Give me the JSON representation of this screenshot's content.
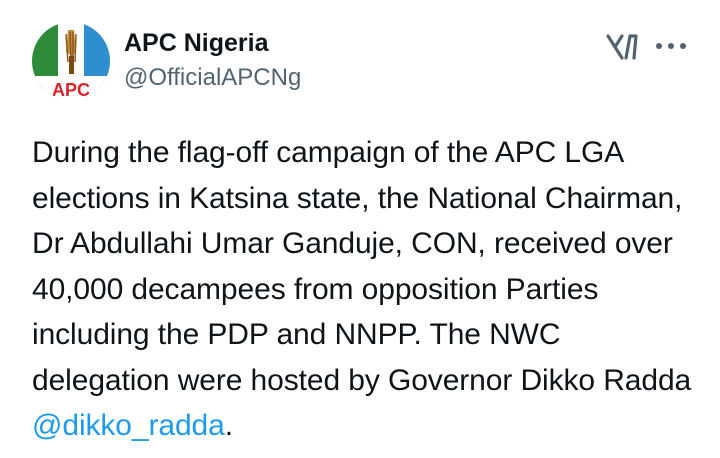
{
  "account": {
    "display_name": "APC Nigeria",
    "handle": "@OfficialAPCNg",
    "avatar_text": "APC",
    "avatar_icon": "broom-logo"
  },
  "actions": {
    "grok_icon": "grok-icon",
    "more_icon": "more-options-icon"
  },
  "tweet": {
    "text_before": "During the flag-off campaign of the APC LGA elections in Katsina state, the National Chairman, Dr Abdullahi Umar Ganduje, CON, received over 40,000 decampees from opposition Parties including the PDP and NNPP. The NWC delegation were hosted by Governor Dikko Radda ",
    "mention": "@dikko_radda",
    "text_after": "."
  },
  "colors": {
    "text": "#0f1419",
    "secondary": "#536471",
    "link": "#1d9bf0",
    "logo_green": "#2e8b3a",
    "logo_white": "#ffffff",
    "logo_blue": "#2f8ecf",
    "logo_red": "#d8232a"
  }
}
